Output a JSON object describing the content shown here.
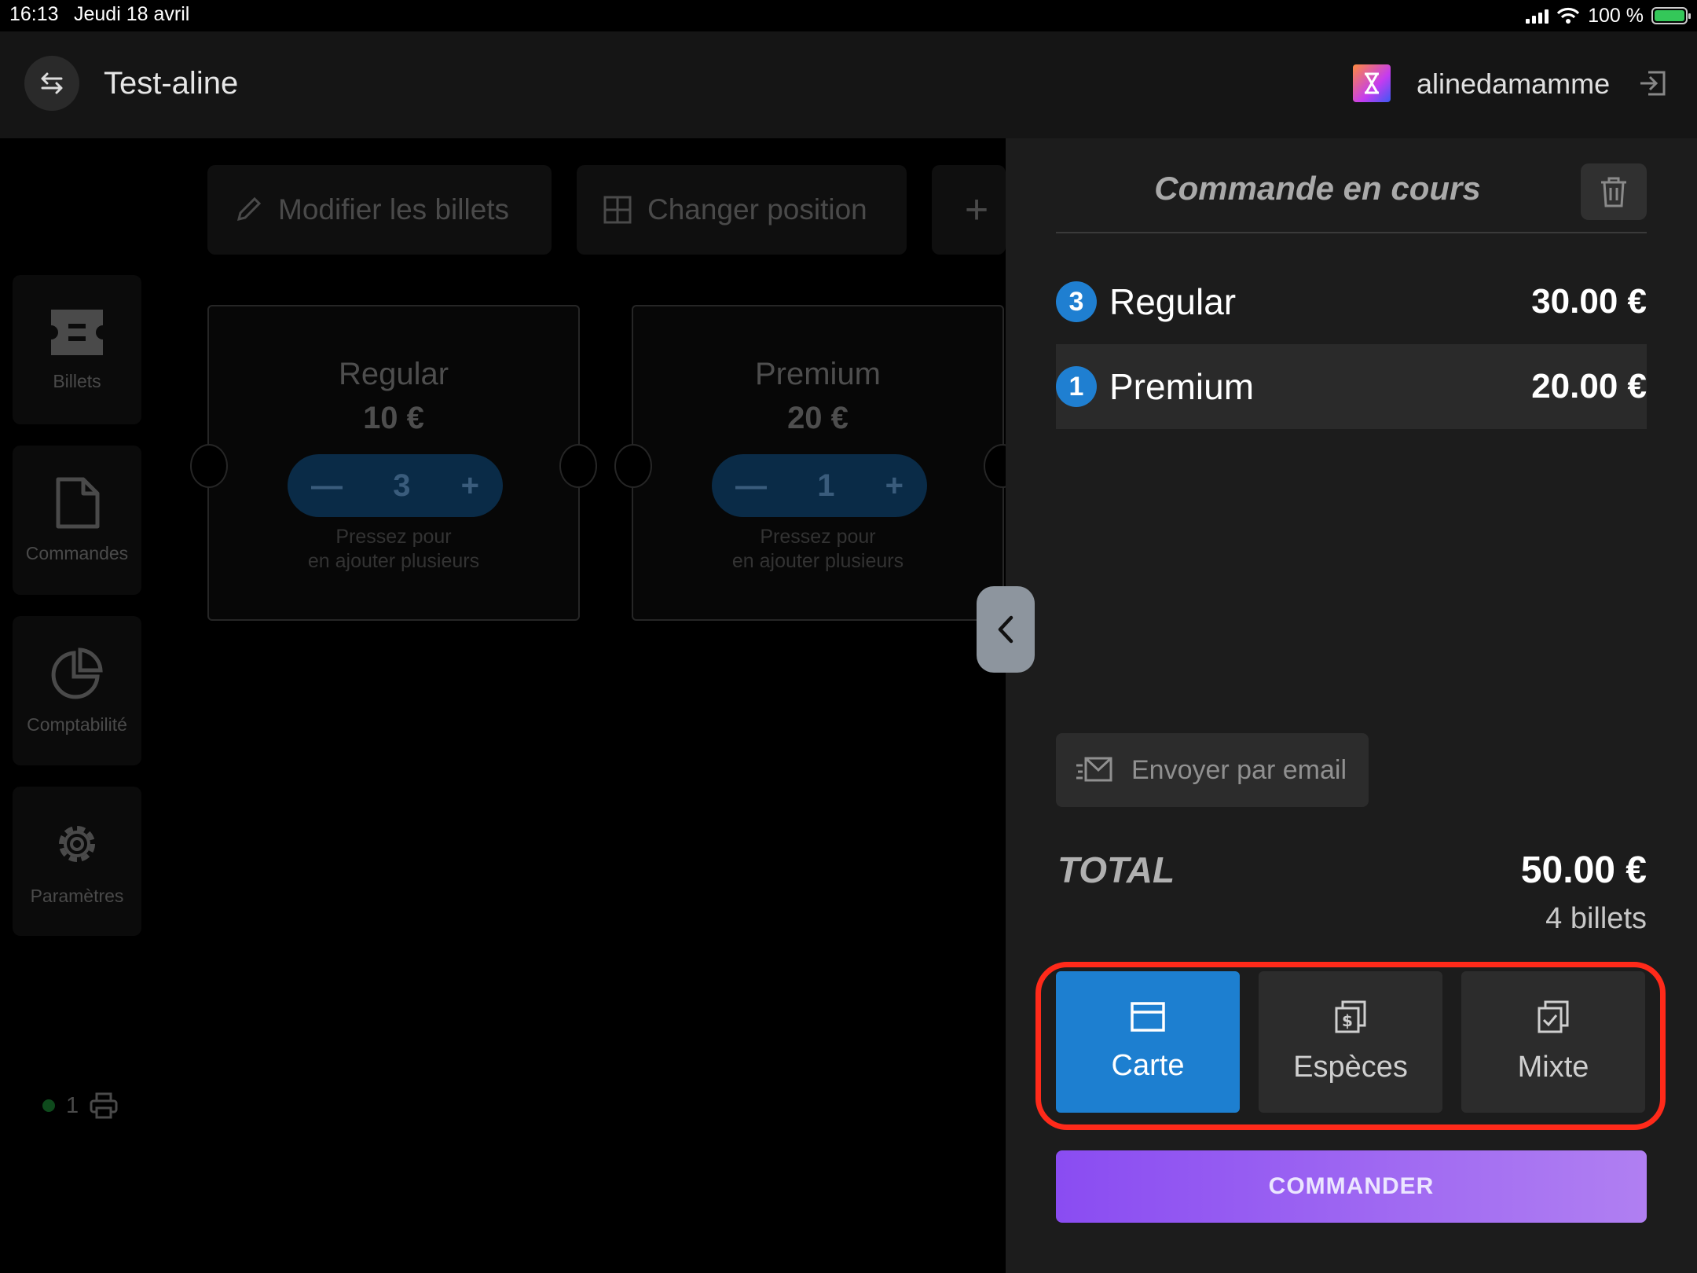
{
  "status_bar": {
    "time": "16:13",
    "date": "Jeudi 18 avril",
    "battery_text": "100 %"
  },
  "header": {
    "event_name": "Test-aline",
    "username": "alinedamamme"
  },
  "toolbar": {
    "edit_label": "Modifier les billets",
    "position_label": "Changer position",
    "add_label": "+"
  },
  "sidebar": {
    "items": [
      {
        "label": "Billets",
        "icon": "ticket-icon"
      },
      {
        "label": "Commandes",
        "icon": "document-icon"
      },
      {
        "label": "Comptabilité",
        "icon": "pie-chart-icon"
      },
      {
        "label": "Paramètres",
        "icon": "gear-icon"
      }
    ],
    "printer_count": "1"
  },
  "tickets": [
    {
      "name": "Regular",
      "price": "10 €",
      "qty": "3",
      "hint_line1": "Pressez pour",
      "hint_line2": "en ajouter plusieurs"
    },
    {
      "name": "Premium",
      "price": "20 €",
      "qty": "1",
      "hint_line1": "Pressez pour",
      "hint_line2": "en ajouter plusieurs"
    }
  ],
  "order": {
    "title": "Commande en cours",
    "lines": [
      {
        "qty": "3",
        "name": "Regular",
        "amount": "30.00 €",
        "selected": false
      },
      {
        "qty": "1",
        "name": "Premium",
        "amount": "20.00 €",
        "selected": true
      }
    ],
    "email_label": "Envoyer par email",
    "total_label": "TOTAL",
    "total_amount": "50.00 €",
    "total_count": "4 billets",
    "payment": {
      "card": "Carte",
      "cash": "Espèces",
      "mixed": "Mixte",
      "selected": "card"
    },
    "submit_label": "COMMANDER"
  },
  "colors": {
    "accent_blue": "#1d7fd0",
    "submit_gradient_start": "#8a4cf2",
    "submit_gradient_end": "#b07ff2",
    "highlight_frame": "#ff2a1a"
  }
}
